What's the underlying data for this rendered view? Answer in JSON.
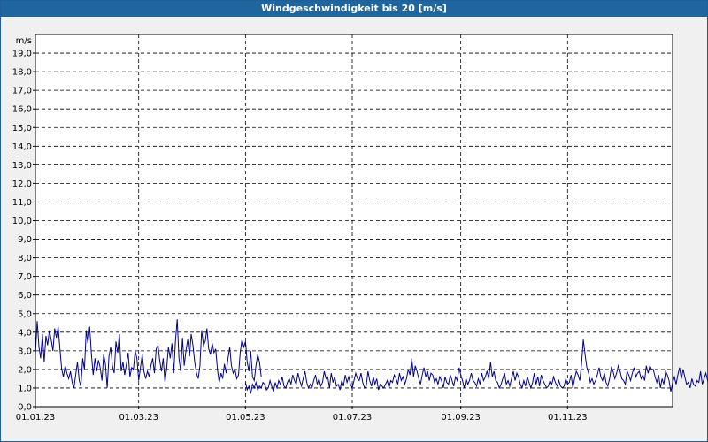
{
  "window": {
    "title": "Windgeschwindigkeit bis 20 [m/s]"
  },
  "colors": {
    "line": "#00008b",
    "grid": "#000000",
    "plot_bg": "#ffffff",
    "titlebar": "#1f66a0"
  },
  "chart_data": {
    "type": "line",
    "title": "Windgeschwindigkeit bis 20 [m/s]",
    "ylabel": "m/s",
    "xlabel": "",
    "ylim": [
      0,
      20
    ],
    "xlim": [
      "2023-01-01",
      "2023-12-31"
    ],
    "yticks": [
      "0,0",
      "1,0",
      "2,0",
      "3,0",
      "4,0",
      "5,0",
      "6,0",
      "7,0",
      "8,0",
      "9,0",
      "10,0",
      "11,0",
      "12,0",
      "13,0",
      "14,0",
      "15,0",
      "16,0",
      "17,0",
      "18,0",
      "19,0"
    ],
    "xticks": [
      {
        "date": "2023-01-01",
        "label": "01.01.23"
      },
      {
        "date": "2023-03-01",
        "label": "01.03.23"
      },
      {
        "date": "2023-05-01",
        "label": "01.05.23"
      },
      {
        "date": "2023-07-01",
        "label": "01.07.23"
      },
      {
        "date": "2023-09-01",
        "label": "01.09.23"
      },
      {
        "date": "2023-11-01",
        "label": "01.11.23"
      }
    ],
    "grid": true,
    "series": [
      {
        "segments": [
          {
            "start": "2023-01-01",
            "values": [
              2.8,
              4.6,
              3.2,
              2.6,
              3.9,
              2.4,
              3.8,
              3.3,
              4.1,
              3.6,
              3.0,
              4.2,
              3.7,
              4.3,
              3.1,
              2.0,
              1.6,
              2.2,
              1.8,
              1.5,
              1.9,
              1.3,
              1.0,
              1.7,
              2.4,
              1.4,
              1.1,
              2.6,
              2.0,
              4.1,
              3.4,
              4.3,
              2.8,
              1.7,
              2.6,
              1.9,
              2.5,
              2.1,
              1.4,
              2.8,
              2.3,
              1.0,
              2.7,
              3.2,
              2.2,
              1.8,
              3.5,
              2.9,
              3.9,
              1.9,
              2.4,
              1.7,
              2.3,
              2.9,
              1.6,
              2.1,
              2.0,
              3.0,
              2.6,
              1.4,
              2.1,
              2.8,
              1.9,
              1.5,
              1.9,
              1.6,
              2.2,
              2.6,
              1.8,
              3.1,
              3.3,
              2.5,
              1.9,
              2.6,
              1.3,
              2.1,
              3.2,
              2.6,
              3.4,
              1.8,
              3.5,
              4.7,
              2.6,
              1.9,
              3.7,
              2.2,
              3.0,
              3.6,
              2.7,
              3.9,
              3.3,
              2.4,
              1.8,
              1.5,
              2.2,
              4.1,
              3.3,
              3.5,
              4.2,
              3.1,
              2.8,
              3.4,
              2.9,
              3.1,
              2.0,
              1.3,
              1.8,
              1.5,
              2.3,
              1.8,
              2.6,
              3.2,
              2.2,
              1.8,
              2.0,
              1.5,
              1.7,
              2.9,
              3.6,
              3.2,
              3.5,
              2.4,
              1.9,
              3.0,
              1.6,
              1.4,
              2.2,
              2.8,
              2.4,
              1.6
            ]
          },
          {
            "start": "2023-05-01",
            "values": [
              1.3,
              0.9,
              1.1,
              0.7,
              1.2,
              1.0,
              1.3,
              0.9,
              1.1,
              1.0,
              1.3,
              1.2,
              0.9,
              1.0,
              1.4,
              1.1,
              0.8,
              1.3,
              1.0,
              1.4,
              1.2,
              1.6,
              1.1,
              1.0,
              1.3,
              1.5,
              1.2,
              1.7,
              1.4,
              1.2,
              1.8,
              1.4,
              1.1,
              1.5,
              1.9,
              1.3,
              1.0,
              1.2,
              1.0,
              1.4,
              1.7,
              1.2,
              1.5,
              1.1,
              1.3,
              1.9,
              1.5,
              1.6,
              1.0,
              1.8,
              1.3,
              1.6,
              1.1,
              1.2,
              0.9,
              1.4,
              1.1,
              1.7,
              1.3,
              1.6,
              1.2,
              1.0,
              1.4,
              1.8,
              1.5,
              1.4,
              1.8,
              1.3,
              1.0,
              1.1,
              1.9,
              1.4,
              1.1,
              1.6,
              1.2,
              1.5,
              0.9,
              1.2,
              1.1,
              1.0,
              1.2,
              1.4,
              1.0,
              1.4,
              1.3,
              1.7,
              1.5,
              1.2,
              1.8,
              1.4,
              1.6,
              1.2,
              1.5,
              2.0,
              1.7,
              2.6,
              1.6,
              2.2,
              1.9,
              1.5,
              1.2,
              1.7,
              2.1,
              1.6,
              1.9,
              1.4,
              1.8,
              1.7,
              1.3,
              1.5,
              1.2,
              1.6,
              1.4,
              1.0,
              1.6,
              1.3,
              1.2,
              1.7,
              1.4,
              1.1,
              1.6,
              1.4,
              2.1,
              1.7,
              1.4,
              1.0,
              1.5,
              1.2,
              1.4,
              1.8,
              1.4,
              1.3,
              1.1,
              1.5,
              1.2,
              1.8,
              1.4,
              1.6,
              1.9,
              1.5,
              2.4,
              1.6,
              1.9,
              1.4,
              1.3,
              1.0,
              1.2,
              1.5,
              1.8,
              1.2,
              1.4,
              1.1,
              1.5,
              1.9,
              1.4,
              1.8,
              1.6,
              1.2,
              1.0,
              1.4,
              1.1,
              1.6,
              1.3,
              1.0,
              1.3,
              1.8,
              1.2,
              1.6,
              1.1,
              1.7,
              1.4,
              1.2,
              1.0,
              1.1,
              1.4,
              1.2,
              1.6,
              1.3,
              1.1,
              1.4,
              1.1,
              1.0,
              1.1,
              1.5,
              1.2,
              1.3,
              1.7,
              1.0,
              1.5,
              1.9,
              1.7,
              1.4,
              2.3,
              3.6,
              2.8,
              2.1,
              1.8,
              1.3,
              1.5,
              1.2,
              1.4,
              1.7,
              2.1,
              1.6,
              1.4,
              1.8,
              1.3,
              1.1,
              1.5,
              2.1,
              1.9,
              1.5,
              1.8,
              2.2,
              1.9,
              1.5,
              1.4,
              1.2,
              1.9,
              1.7,
              1.4,
              1.8,
              2.1,
              1.6,
              1.8,
              1.9,
              1.5,
              1.7,
              1.4,
              2.2,
              1.8,
              2.2,
              2.0,
              2.0,
              1.6,
              1.3,
              1.7,
              1.0,
              1.5,
              1.2,
              1.9,
              1.7,
              1.4,
              0.8,
              1.3,
              1.6,
              1.2,
              1.7,
              2.1,
              1.5,
              2.0,
              1.6,
              1.2,
              1.3,
              1.0,
              1.5,
              1.2,
              1.1,
              1.4,
              1.3,
              1.9,
              1.2,
              1.5,
              1.8,
              1.4,
              1.2,
              1.6,
              1.1,
              1.3,
              1.5,
              1.8,
              1.4,
              1.3,
              1.1,
              1.7,
              1.3,
              2.2,
              1.7,
              1.3,
              2.6,
              4.3,
              2.6,
              1.7,
              2.2,
              1.5,
              2.8,
              1.9,
              2.4,
              1.5,
              1.8,
              2.6,
              1.3,
              1.9,
              1.5,
              1.4,
              1.8,
              1.2,
              2.1,
              2.8,
              1.9,
              1.6,
              1.3,
              1.9,
              2.5,
              1.7,
              1.4,
              3.7,
              2.2,
              3.4,
              2.9,
              2.1,
              2.4,
              1.7,
              2.5,
              1.9,
              1.6,
              2.2,
              1.8,
              1.5,
              2.0,
              1.7,
              2.3,
              1.9,
              1.6,
              1.4,
              1.7,
              1.9,
              1.2,
              1.5,
              2.5,
              2.3,
              1.7,
              1.9,
              2.4,
              1.6,
              2.1,
              1.8,
              1.5,
              1.3,
              1.8,
              1.6,
              2.2,
              1.9,
              1.7,
              1.5,
              1.2,
              1.7,
              1.4,
              1.0,
              1.1,
              1.5,
              1.6,
              1.2,
              0.9,
              1.4,
              1.7,
              1.5,
              1.7
            ]
          }
        ]
      }
    ]
  }
}
